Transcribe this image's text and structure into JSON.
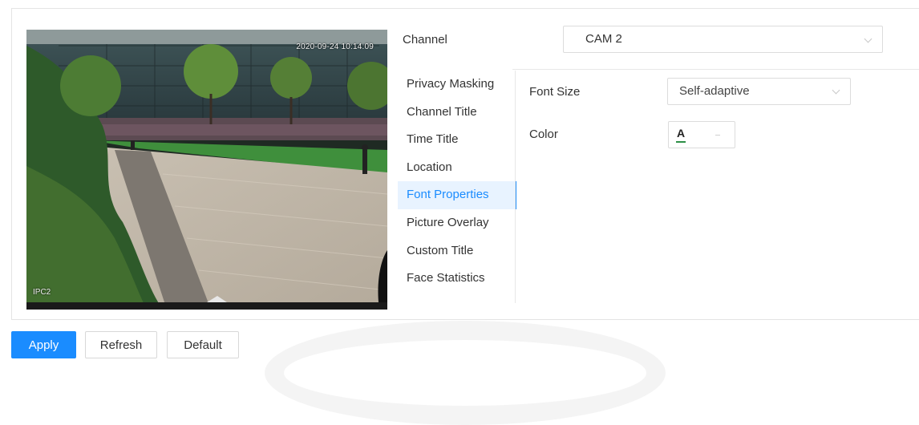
{
  "video": {
    "timestamp": "2020-09-24 10:14:09",
    "channel_osd": "IPC2"
  },
  "channel": {
    "label": "Channel",
    "value": "CAM 2"
  },
  "menu": {
    "items": [
      {
        "label": "Privacy Masking",
        "active": false
      },
      {
        "label": "Channel Title",
        "active": false
      },
      {
        "label": "Time Title",
        "active": false
      },
      {
        "label": "Location",
        "active": false
      },
      {
        "label": "Font Properties",
        "active": true
      },
      {
        "label": "Picture Overlay",
        "active": false
      },
      {
        "label": "Custom Title",
        "active": false
      },
      {
        "label": "Face Statistics",
        "active": false
      }
    ]
  },
  "font_properties": {
    "font_size_label": "Font Size",
    "font_size_value": "Self-adaptive",
    "color_label": "Color",
    "color_glyph": "A",
    "color_value": "#2d8f47"
  },
  "buttons": {
    "apply": "Apply",
    "refresh": "Refresh",
    "default": "Default"
  },
  "colors": {
    "accent": "#1a8cff",
    "active_bg": "#e8f3ff",
    "border": "#dcdcdc"
  }
}
